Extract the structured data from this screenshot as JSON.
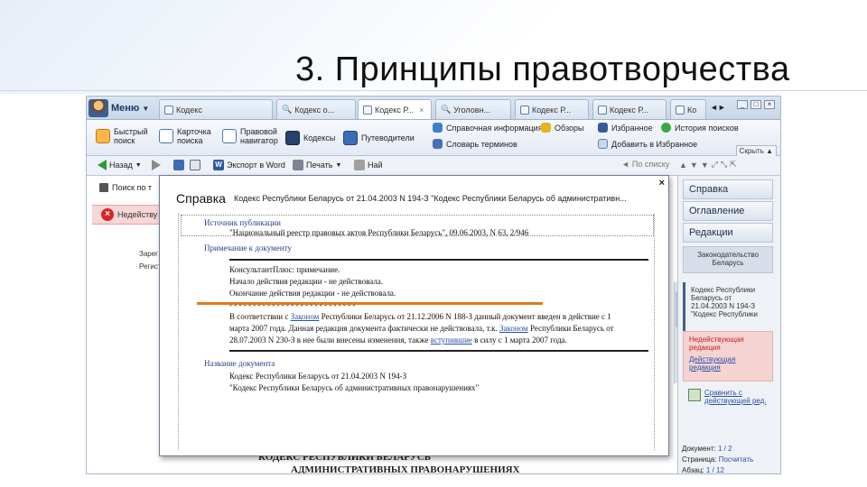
{
  "slide": {
    "title": "3. Принципы правотворчества"
  },
  "tabs": {
    "menu_label": "Меню",
    "items": [
      {
        "label": "Кодекс",
        "active": false
      },
      {
        "label": "Кодекс о...",
        "active": false
      },
      {
        "label": "Кодекс Р...",
        "active": true
      },
      {
        "label": "Уголовн...",
        "active": false
      },
      {
        "label": "Кодекс Р...",
        "active": false
      },
      {
        "label": "Кодекс Р...",
        "active": false
      },
      {
        "label": "Ко",
        "active": false
      }
    ]
  },
  "ribbon": {
    "quick_search": "Быстрый поиск",
    "card_search": "Карточка поиска",
    "legal_navigator": "Правовой навигатор",
    "codes": "Кодексы",
    "guides": "Путеводители",
    "reference": "Справочная информация",
    "dictionary": "Словарь терминов",
    "reviews": "Обзоры",
    "favorites": "Избранное",
    "history": "История поисков",
    "add_favorites": "Добавить в Избранное",
    "hide": "Скрыть"
  },
  "toolbar": {
    "back": "Назад",
    "export_word": "Экспорт в Word",
    "print": "Печать",
    "find": "Най",
    "by_list": "По списку"
  },
  "document": {
    "search_tab": "Поиск по т",
    "warning": "Недейству",
    "bg_line1": "Зарег",
    "bg_line2": "Регист",
    "bottom_line1": "КОДЕКС РЕСПУБЛИКИ БЕЛАРУСЬ",
    "bottom_line2": "АДМИНИСТРАТИВНЫХ ПРАВОНАРУШЕНИЯХ"
  },
  "popup": {
    "title": "Справка",
    "subtitle": "Кодекс Республики Беларусь от 21.04.2003 N 194-З \"Кодекс Республики Беларусь об административн...",
    "close": "×",
    "source_header": "Источник публикации",
    "source_text": "\"Национальный реестр правовых актов Республики Беларусь\", 09.06.2003, N 63, 2/946",
    "note_header": "Примечание к документу",
    "note_1": "КонсультантПлюс: примечание.",
    "note_2": "Начало действия редакции - не действовала.",
    "note_3": "Окончание действия редакции - не действовала.",
    "dashes": "- - - - - - - - - - - - - - - - - - - - - - - - - - -",
    "p1_a": "В соответствии с",
    "p1_link": "Законом",
    "p1_b": "Республики Беларусь от 21.12.2006 N 188-З данный документ введен в действие с 1",
    "p2": "марта 2007 года. Данная редакция документа фактически не действовала, т.к.",
    "p2_link": "Законом",
    "p2_b": "Республики Беларусь от",
    "p3_a": "28.07.2003 N 230-З в нее были внесены изменения, также",
    "p3_link": "вступившие",
    "p3_b": "в силу с 1 марта 2007 года.",
    "name_header": "Название документа",
    "name_1": "Кодекс Республики Беларусь от 21.04.2003 N 194-З",
    "name_2": "\"Кодекс Республики Беларусь об административных правонарушениях\""
  },
  "right_panel": {
    "tab_help": "Справка",
    "tab_contents": "Оглавление",
    "tab_editions": "Редакции",
    "law_label": "Законодательство Беларусь",
    "code_ref": "Кодекс Республики Беларусь от 21.04.2003 N 194-З \"Кодекс Республики",
    "invalid_a": "Недействующая редакция",
    "invalid_link": "Действующая редакция",
    "compare": "Сравнить с действующей ред.",
    "doc_label": "Документ:",
    "doc_value": "1 / 2",
    "page_label": "Страница:",
    "page_value": "Посчитать",
    "para_label": "Абзац:",
    "para_value": "1 / 12"
  }
}
